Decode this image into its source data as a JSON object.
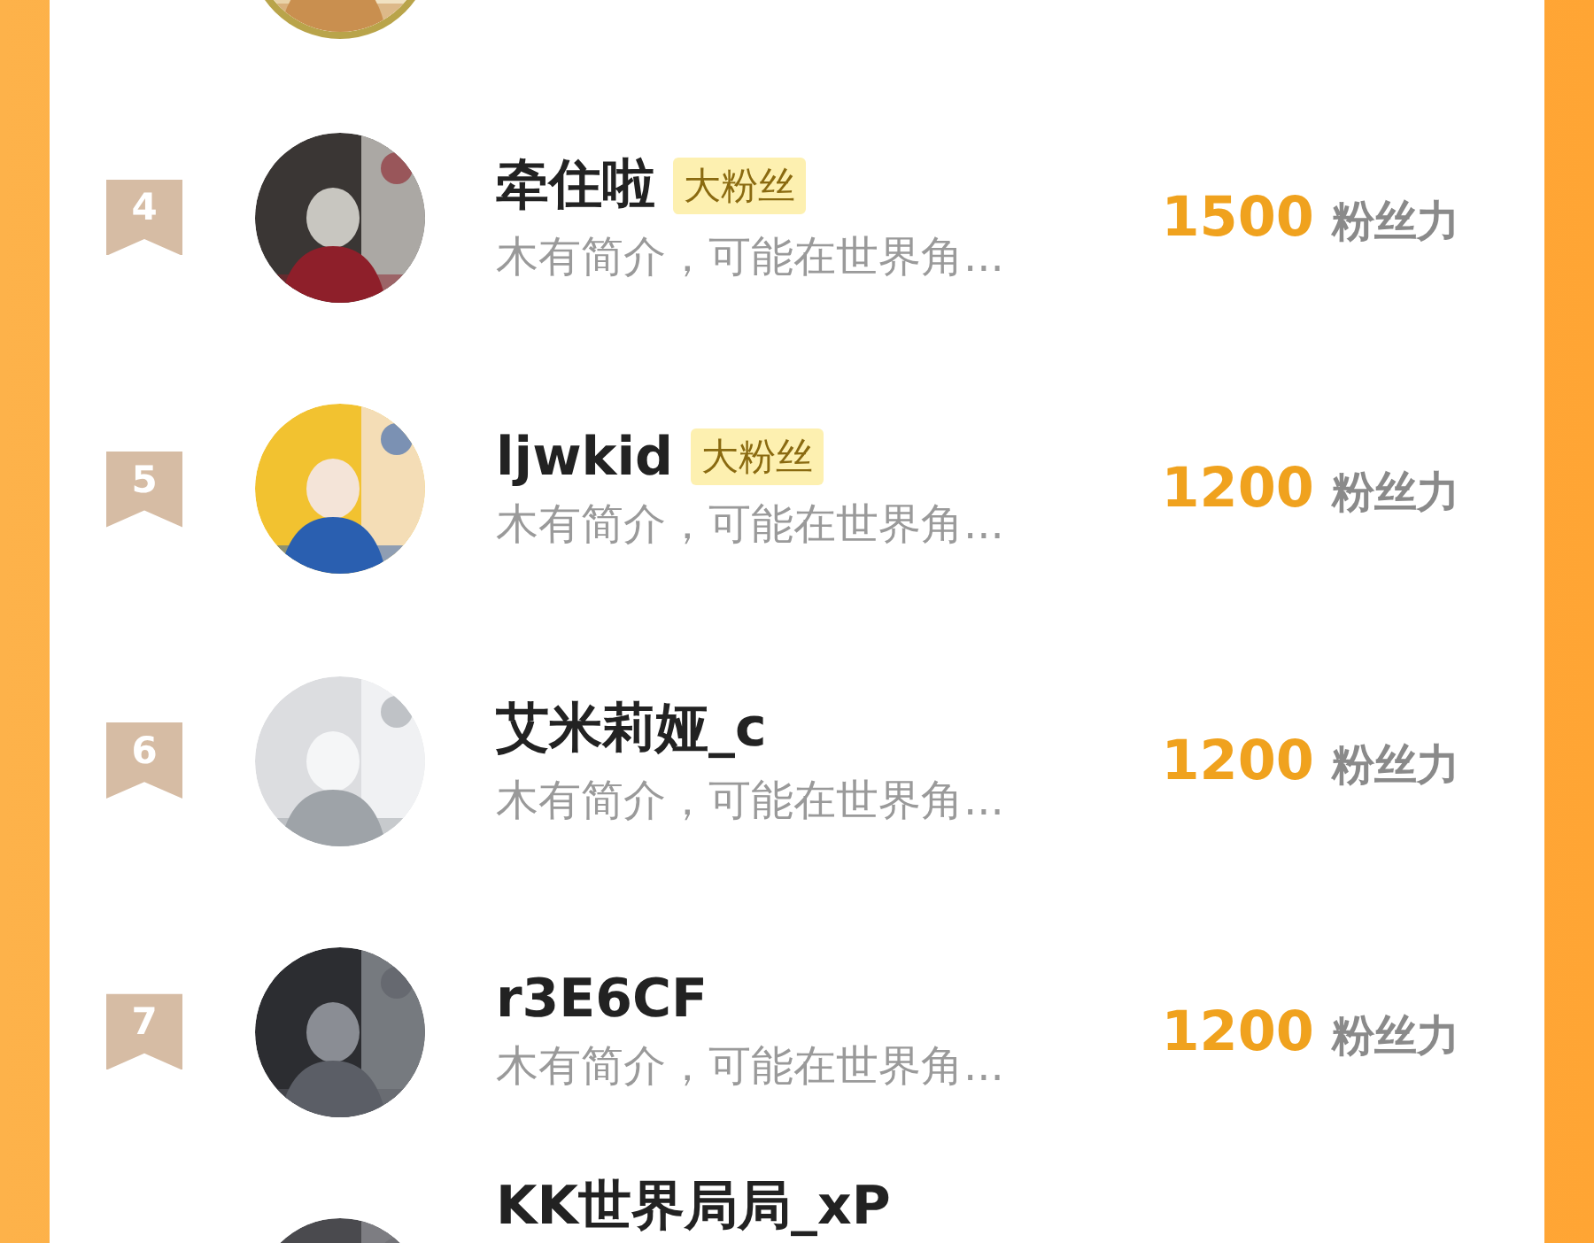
{
  "rows": [
    {
      "avatar": {
        "kind": "picture"
      }
    },
    {
      "rank": "4",
      "avatar": {
        "kind": "picture"
      },
      "name": "牵住啦",
      "badge": "大粉丝",
      "bio": "木有简介，可能在世界角...",
      "score": "1500",
      "score_unit": "粉丝力"
    },
    {
      "rank": "5",
      "avatar": {
        "kind": "picture"
      },
      "name": "ljwkid",
      "badge": "大粉丝",
      "bio": "木有简介，可能在世界角...",
      "score": "1200",
      "score_unit": "粉丝力"
    },
    {
      "rank": "6",
      "avatar": {
        "kind": "picture"
      },
      "name": "艾米莉娅_c",
      "bio": "木有简介，可能在世界角...",
      "score": "1200",
      "score_unit": "粉丝力"
    },
    {
      "rank": "7",
      "avatar": {
        "kind": "picture"
      },
      "name": "r3E6CF",
      "bio": "木有简介，可能在世界角...",
      "score": "1200",
      "score_unit": "粉丝力"
    },
    {
      "avatar": {
        "kind": "picture"
      },
      "name": "KK世界局局_xP"
    }
  ]
}
